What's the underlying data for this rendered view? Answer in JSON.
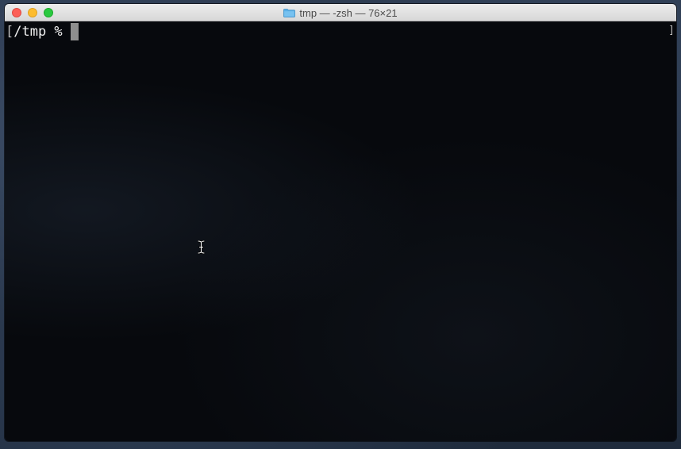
{
  "window": {
    "title": "tmp — -zsh — 76×21"
  },
  "terminal": {
    "prompt_bracket": "[",
    "prompt": "/tmp %",
    "right_bracket": "]"
  },
  "icons": {
    "folder": "folder-icon",
    "cursor": "text-cursor-icon"
  },
  "colors": {
    "close": "#fc5f57",
    "minimize": "#fdbc2e",
    "zoom": "#2ac940",
    "terminal_bg": "#07090d",
    "text": "#f2f2f2",
    "folder": "#5ab0e8"
  }
}
